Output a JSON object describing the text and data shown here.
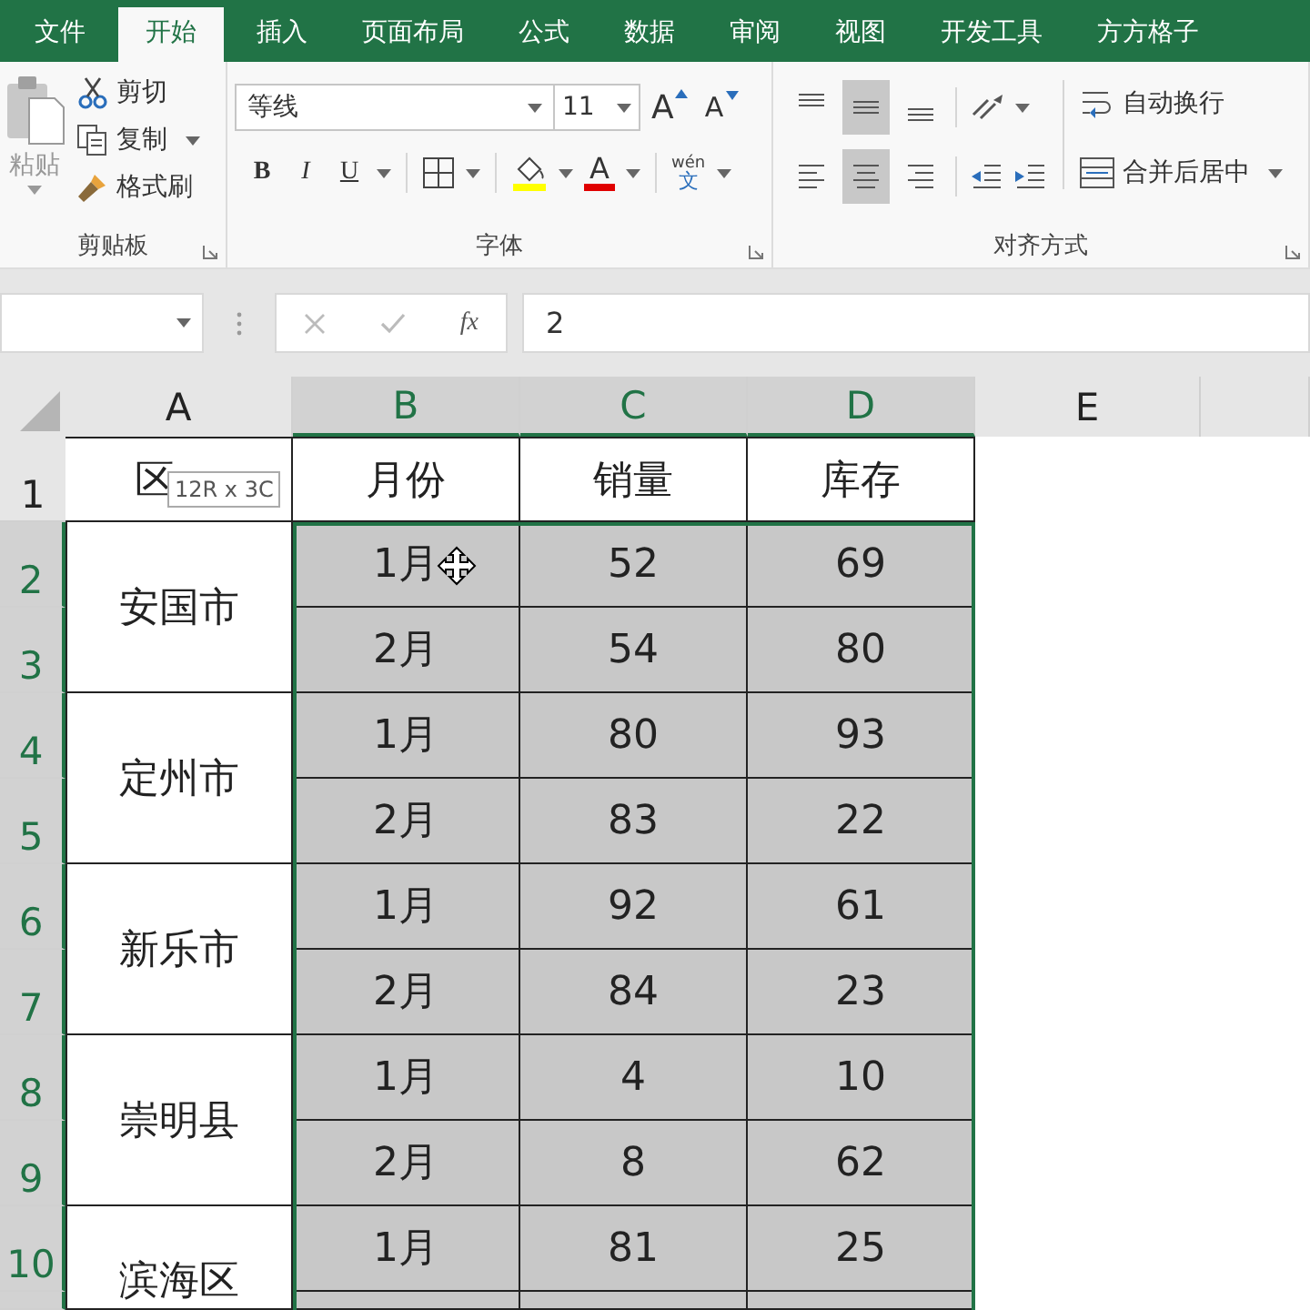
{
  "tabs": [
    {
      "label": "文件",
      "selected": false
    },
    {
      "label": "开始",
      "selected": true
    },
    {
      "label": "插入",
      "selected": false
    },
    {
      "label": "页面布局",
      "selected": false
    },
    {
      "label": "公式",
      "selected": false
    },
    {
      "label": "数据",
      "selected": false
    },
    {
      "label": "审阅",
      "selected": false
    },
    {
      "label": "视图",
      "selected": false
    },
    {
      "label": "开发工具",
      "selected": false
    },
    {
      "label": "方方格子",
      "selected": false
    }
  ],
  "clipboard": {
    "paste": "粘贴",
    "cut": "剪切",
    "copy": "复制",
    "format_painter": "格式刷",
    "label": "剪贴板"
  },
  "font": {
    "name": "等线",
    "size": "11",
    "grow": "A",
    "shrink": "A",
    "bold": "B",
    "italic": "I",
    "underline": "U",
    "font_color": "A",
    "phonetic_top": "wén",
    "phonetic_bottom": "文",
    "label": "字体"
  },
  "alignment": {
    "vertical": [
      {
        "kind": "top",
        "selected": false
      },
      {
        "kind": "middle",
        "selected": true
      },
      {
        "kind": "bottom",
        "selected": false
      }
    ],
    "horizontal": [
      {
        "kind": "left",
        "selected": false
      },
      {
        "kind": "center",
        "selected": true
      },
      {
        "kind": "right",
        "selected": false
      }
    ],
    "wrap": "自动换行",
    "merge": "合并后居中",
    "label": "对齐方式"
  },
  "formula_bar": {
    "fx": "fx",
    "value": "2"
  },
  "columns": [
    {
      "label": "A",
      "selected": false
    },
    {
      "label": "B",
      "selected": true
    },
    {
      "label": "C",
      "selected": true
    },
    {
      "label": "D",
      "selected": true
    },
    {
      "label": "E",
      "selected": false
    }
  ],
  "rows": [
    {
      "label": "1",
      "selected": false
    },
    {
      "label": "2",
      "selected": true
    },
    {
      "label": "3",
      "selected": true
    },
    {
      "label": "4",
      "selected": true
    },
    {
      "label": "5",
      "selected": true
    },
    {
      "label": "6",
      "selected": true
    },
    {
      "label": "7",
      "selected": true
    },
    {
      "label": "8",
      "selected": true
    },
    {
      "label": "9",
      "selected": true
    },
    {
      "label": "10",
      "selected": true
    }
  ],
  "header": [
    "区",
    "月份",
    "销量",
    "库存"
  ],
  "regions": [
    {
      "name": "安国市",
      "months": [
        {
          "month": "1月",
          "sales": "52",
          "stock": "69"
        },
        {
          "month": "2月",
          "sales": "54",
          "stock": "80"
        }
      ]
    },
    {
      "name": "定州市",
      "months": [
        {
          "month": "1月",
          "sales": "80",
          "stock": "93"
        },
        {
          "month": "2月",
          "sales": "83",
          "stock": "22"
        }
      ]
    },
    {
      "name": "新乐市",
      "months": [
        {
          "month": "1月",
          "sales": "92",
          "stock": "61"
        },
        {
          "month": "2月",
          "sales": "84",
          "stock": "23"
        }
      ]
    },
    {
      "name": "崇明县",
      "months": [
        {
          "month": "1月",
          "sales": "4",
          "stock": "10"
        },
        {
          "month": "2月",
          "sales": "8",
          "stock": "62"
        }
      ]
    },
    {
      "name": "滨海区",
      "months": [
        {
          "month": "1月",
          "sales": "81",
          "stock": "25"
        }
      ]
    }
  ],
  "tooltip": "12R x 3C"
}
